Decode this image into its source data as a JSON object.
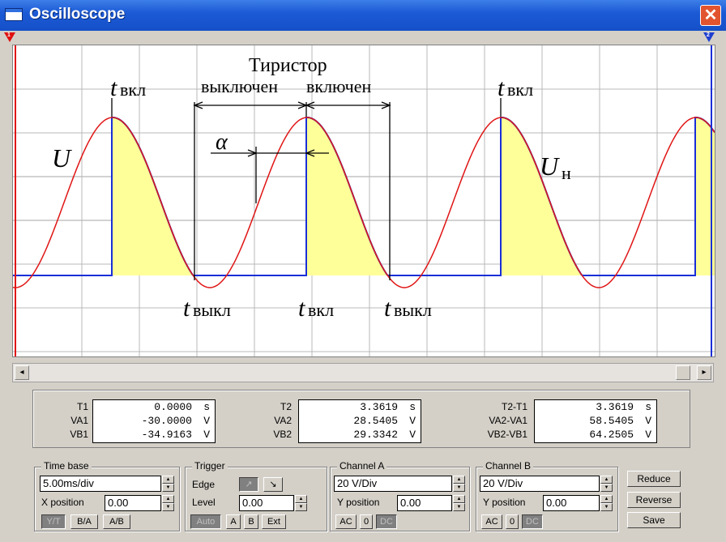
{
  "window": {
    "title": "Oscilloscope",
    "close_label": "✕"
  },
  "ruler": {
    "marker1": "1",
    "marker2": "2"
  },
  "screen": {
    "annotations": {
      "u_label": "U",
      "un_main": "U",
      "un_sub": "н",
      "tyristor": "Тиристор",
      "off_label": "выключен",
      "on_label": "включен",
      "alpha": "α",
      "t_on_main": "t",
      "t_on_sub": "вкл",
      "t_off_main": "t",
      "t_off_sub": "выкл"
    },
    "colors": {
      "grid": "#b8b8b8",
      "channel_a": "#e01414",
      "channel_b": "#1a2fd8",
      "fill": "#ffff99",
      "annotation": "#000000"
    }
  },
  "scrollbar": {
    "left_arrow": "◂",
    "right_arrow": "▸"
  },
  "readouts": {
    "t1": {
      "label": "T1",
      "value": "0.0000",
      "unit": "s"
    },
    "va1": {
      "label": "VA1",
      "value": "-30.0000",
      "unit": "V"
    },
    "vb1": {
      "label": "VB1",
      "value": "-34.9163",
      "unit": "V"
    },
    "t2": {
      "label": "T2",
      "value": "3.3619",
      "unit": "s"
    },
    "va2": {
      "label": "VA2",
      "value": "28.5405",
      "unit": "V"
    },
    "vb2": {
      "label": "VB2",
      "value": "29.3342",
      "unit": "V"
    },
    "dt": {
      "label": "T2-T1",
      "value": "3.3619",
      "unit": "s"
    },
    "dva": {
      "label": "VA2-VA1",
      "value": "58.5405",
      "unit": "V"
    },
    "dvb": {
      "label": "VB2-VB1",
      "value": "64.2505",
      "unit": "V"
    }
  },
  "timebase": {
    "title": "Time base",
    "value": "5.00ms/div",
    "xpos_label": "X position",
    "xpos_value": "0.00",
    "yt": "Y/T",
    "ba": "B/A",
    "ab": "A/B"
  },
  "trigger": {
    "title": "Trigger",
    "edge_label": "Edge",
    "edge_rise": "↗",
    "edge_fall": "↘",
    "level_label": "Level",
    "level_value": "0.00",
    "auto": "Auto",
    "a": "A",
    "b": "B",
    "ext": "Ext"
  },
  "channel_a": {
    "title": "Channel A",
    "value": "20 V/Div",
    "ypos_label": "Y position",
    "ypos_value": "0.00",
    "ac": "AC",
    "zero": "0",
    "dc": "DC"
  },
  "channel_b": {
    "title": "Channel B",
    "value": "20 V/Div",
    "ypos_label": "Y position",
    "ypos_value": "0.00",
    "ac": "AC",
    "zero": "0",
    "dc": "DC"
  },
  "actions": {
    "reduce": "Reduce",
    "reverse": "Reverse",
    "save": "Save"
  }
}
